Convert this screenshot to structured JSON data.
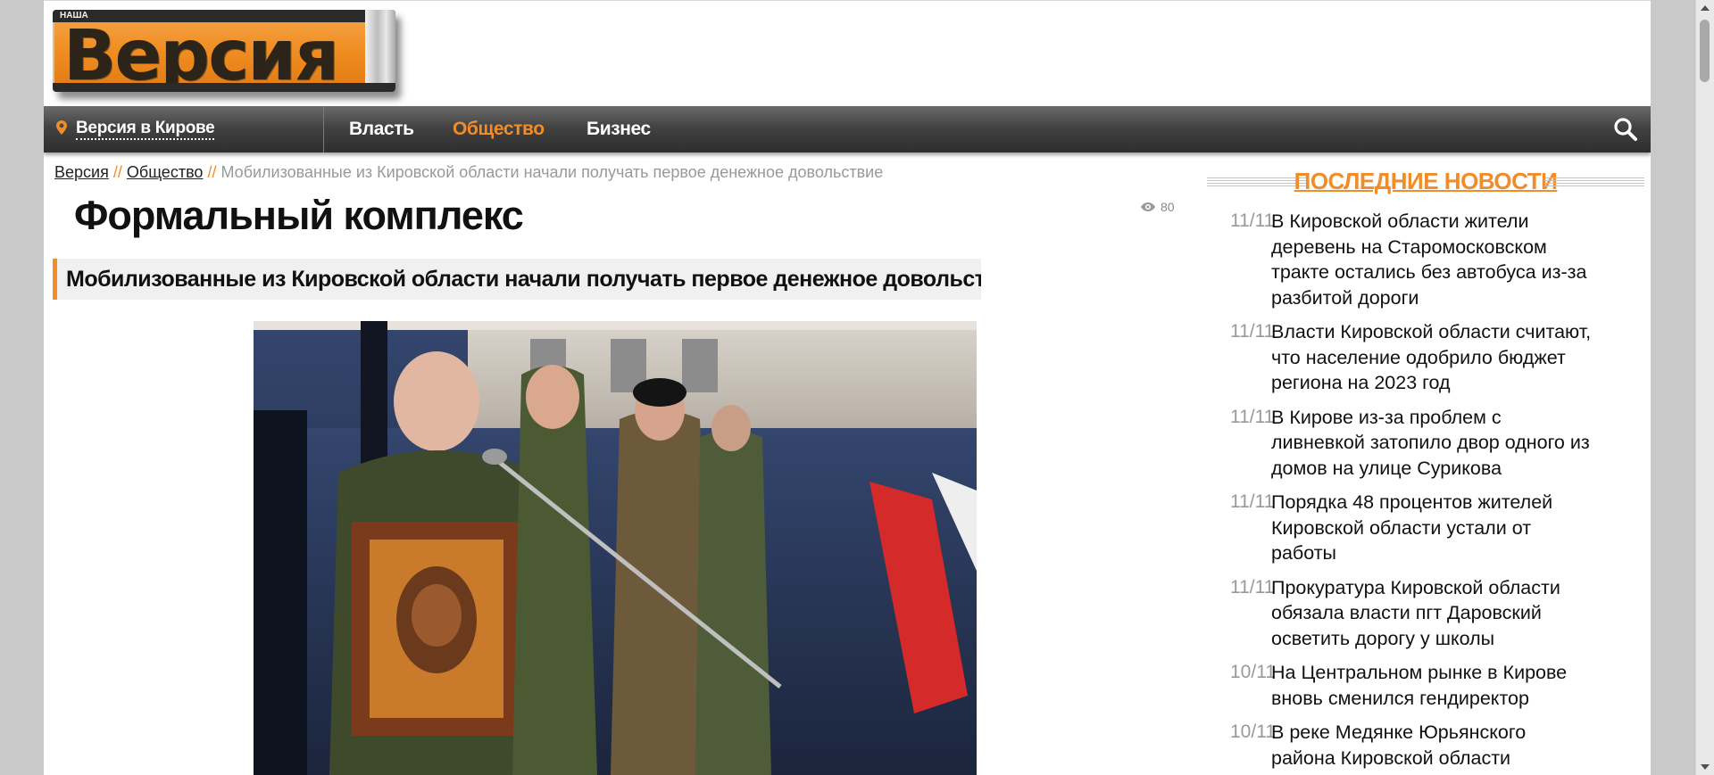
{
  "site": {
    "logo_text": "Версия",
    "logo_top_text": "НАША"
  },
  "nav": {
    "location_label": "Версия в Кирове",
    "items": [
      {
        "label": "Власть",
        "active": false
      },
      {
        "label": "Общество",
        "active": true
      },
      {
        "label": "Бизнес",
        "active": false
      }
    ]
  },
  "breadcrumb": {
    "home": "Версия",
    "separator": "//",
    "section": "Общество",
    "current": "Мобилизованные из Кировской области начали получать первое денежное довольствие"
  },
  "article": {
    "title": "Формальный комплекс",
    "subtitle": "Мобилизованные из Кировской области начали получать первое денежное довольствие",
    "views": "80"
  },
  "news": {
    "heading": "ПОСЛЕДНИЕ НОВОСТИ",
    "items": [
      {
        "date": "11/11",
        "text": "В Кировской области жители деревень на Старомосковском тракте остались без автобуса из-за разбитой дороги"
      },
      {
        "date": "11/11",
        "text": "Власти Кировской области считают, что население одобрило бюджет региона на 2023 год"
      },
      {
        "date": "11/11",
        "text": "В Кирове из-за проблем с ливневкой затопило двор одного из домов на улице Сурикова"
      },
      {
        "date": "11/11",
        "text": "Порядка 48 процентов жителей Кировской области устали от работы"
      },
      {
        "date": "11/11",
        "text": "Прокуратура Кировской области обязала власти пгт Даровский осветить дорогу у школы"
      },
      {
        "date": "10/11",
        "text": "На Центральном рынке в Кирове вновь сменился гендиректор"
      },
      {
        "date": "10/11",
        "text": "В реке Медянке Юрьянского района Кировской области обнаружили токсичные вещества"
      }
    ]
  },
  "colors": {
    "accent": "#f28c28",
    "nav_bg": "#3a3a3a",
    "text": "#111111",
    "muted": "#999999"
  }
}
